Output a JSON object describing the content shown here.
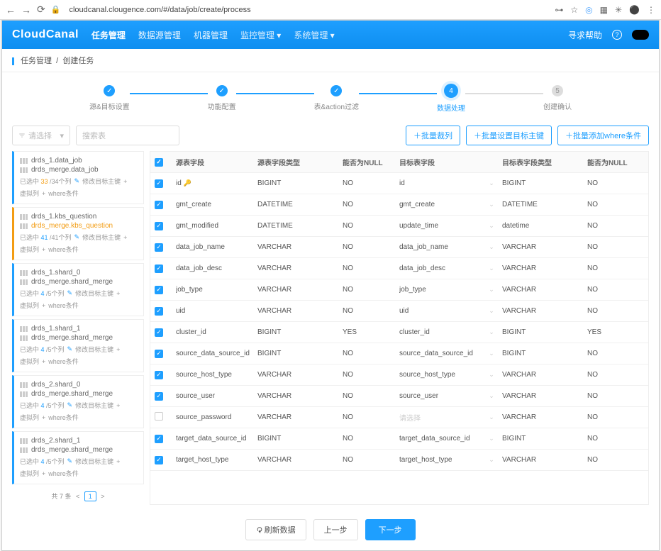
{
  "browser": {
    "url": "cloudcanal.clougence.com/#/data/job/create/process",
    "star": "☆"
  },
  "header": {
    "logo1": "Cloud",
    "logo2": "Canal",
    "nav": [
      "任务管理",
      "数据源管理",
      "机器管理",
      "监控管理",
      "系统管理"
    ],
    "help": "寻求帮助",
    "q": "?"
  },
  "crumb": {
    "a": "任务管理",
    "b": "创建任务"
  },
  "steps": [
    {
      "label": "源&目标设置",
      "check": "✓"
    },
    {
      "label": "功能配置",
      "check": "✓"
    },
    {
      "label": "表&action过滤",
      "check": "✓"
    },
    {
      "label": "数据处理",
      "check": "4"
    },
    {
      "label": "创建确认",
      "check": "5"
    }
  ],
  "toolbar": {
    "select_ph": "请选择",
    "search_ph": "搜索表",
    "btn1": "＋批量裁列",
    "btn2": "＋批量设置目标主键",
    "btn3": "＋批量添加where条件"
  },
  "side": {
    "cards": [
      {
        "t1": "drds_1.data_job",
        "t2": "drds_merge.data_job",
        "sel": "已选中",
        "c1": "33",
        "c2": "/34个列",
        "act1": "修改目标主键",
        "act2": "虚拟列",
        "act3": "where条件",
        "hot": false
      },
      {
        "t1": "drds_1.kbs_question",
        "t2": "drds_merge.kbs_question",
        "sel": "已选中",
        "c1": "41",
        "c2": "/41个列",
        "act1": "修改目标主键",
        "act2": "虚拟列",
        "act3": "where条件",
        "hot": true
      },
      {
        "t1": "drds_1.shard_0",
        "t2": "drds_merge.shard_merge",
        "sel": "已选中",
        "c1": "4",
        "c2": "/5个列",
        "act1": "修改目标主键",
        "act2": "虚拟列",
        "act3": "where条件",
        "hot": false
      },
      {
        "t1": "drds_1.shard_1",
        "t2": "drds_merge.shard_merge",
        "sel": "已选中",
        "c1": "4",
        "c2": "/5个列",
        "act1": "修改目标主键",
        "act2": "虚拟列",
        "act3": "where条件",
        "hot": false
      },
      {
        "t1": "drds_2.shard_0",
        "t2": "drds_merge.shard_merge",
        "sel": "已选中",
        "c1": "4",
        "c2": "/5个列",
        "act1": "修改目标主键",
        "act2": "虚拟列",
        "act3": "where条件",
        "hot": false
      },
      {
        "t1": "drds_2.shard_1",
        "t2": "drds_merge.shard_merge",
        "sel": "已选中",
        "c1": "4",
        "c2": "/5个列",
        "act1": "修改目标主键",
        "act2": "虚拟列",
        "act3": "where条件",
        "hot": false
      }
    ],
    "pager": {
      "total": "共 7 条",
      "p1": "<",
      "p2": "1",
      "p3": ">"
    }
  },
  "grid": {
    "head": {
      "c1": "源表字段",
      "c2": "源表字段类型",
      "c3": "能否为NULL",
      "c4": "目标表字段",
      "c5": "目标表字段类型",
      "c6": "能否为NULL"
    },
    "rows": [
      {
        "chk": true,
        "src": "id",
        "key": true,
        "stype": "BIGINT",
        "snull": "NO",
        "tgt": "id",
        "ttype": "BIGINT",
        "tnull": "NO"
      },
      {
        "chk": true,
        "src": "gmt_create",
        "stype": "DATETIME",
        "snull": "NO",
        "tgt": "gmt_create",
        "ttype": "DATETIME",
        "tnull": "NO"
      },
      {
        "chk": true,
        "src": "gmt_modified",
        "stype": "DATETIME",
        "snull": "NO",
        "tgt": "update_time",
        "ttype": "datetime",
        "tnull": "NO"
      },
      {
        "chk": true,
        "src": "data_job_name",
        "stype": "VARCHAR",
        "snull": "NO",
        "tgt": "data_job_name",
        "ttype": "VARCHAR",
        "tnull": "NO"
      },
      {
        "chk": true,
        "src": "data_job_desc",
        "stype": "VARCHAR",
        "snull": "NO",
        "tgt": "data_job_desc",
        "ttype": "VARCHAR",
        "tnull": "NO"
      },
      {
        "chk": true,
        "src": "job_type",
        "stype": "VARCHAR",
        "snull": "NO",
        "tgt": "job_type",
        "ttype": "VARCHAR",
        "tnull": "NO"
      },
      {
        "chk": true,
        "src": "uid",
        "stype": "VARCHAR",
        "snull": "NO",
        "tgt": "uid",
        "ttype": "VARCHAR",
        "tnull": "NO"
      },
      {
        "chk": true,
        "src": "cluster_id",
        "stype": "BIGINT",
        "snull": "YES",
        "tgt": "cluster_id",
        "ttype": "BIGINT",
        "tnull": "YES"
      },
      {
        "chk": true,
        "src": "source_data_source_id",
        "stype": "BIGINT",
        "snull": "NO",
        "tgt": "source_data_source_id",
        "ttype": "BIGINT",
        "tnull": "NO"
      },
      {
        "chk": true,
        "src": "source_host_type",
        "stype": "VARCHAR",
        "snull": "NO",
        "tgt": "source_host_type",
        "ttype": "VARCHAR",
        "tnull": "NO"
      },
      {
        "chk": true,
        "src": "source_user",
        "stype": "VARCHAR",
        "snull": "NO",
        "tgt": "source_user",
        "ttype": "VARCHAR",
        "tnull": "NO"
      },
      {
        "chk": false,
        "src": "source_password",
        "stype": "VARCHAR",
        "snull": "NO",
        "tgt_ph": "请选择",
        "ttype": "VARCHAR",
        "tnull": "NO"
      },
      {
        "chk": true,
        "src": "target_data_source_id",
        "stype": "BIGINT",
        "snull": "NO",
        "tgt": "target_data_source_id",
        "ttype": "BIGINT",
        "tnull": "NO"
      },
      {
        "chk": true,
        "src": "target_host_type",
        "stype": "VARCHAR",
        "snull": "NO",
        "tgt": "target_host_type",
        "ttype": "VARCHAR",
        "tnull": "NO"
      }
    ]
  },
  "footer": {
    "refresh": "刷新数据",
    "prev": "上一步",
    "next": "下一步"
  }
}
